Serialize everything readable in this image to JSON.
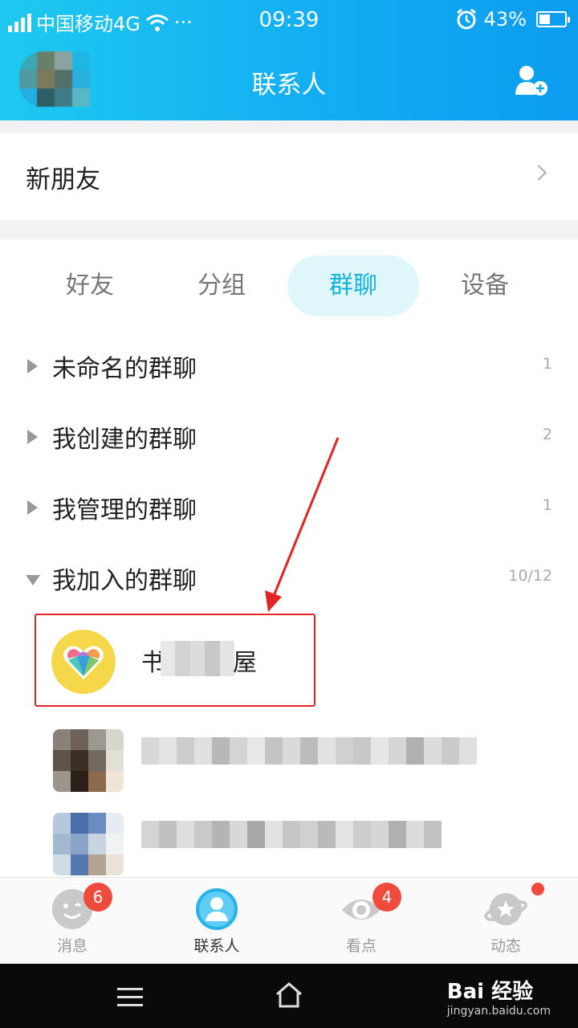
{
  "status_bar": {
    "carrier": "中国移动4G",
    "extra": "···",
    "time": "09:39",
    "battery": "43%",
    "battery_level": 0.43
  },
  "header": {
    "title": "联系人",
    "add_icon": "add-contact-icon"
  },
  "new_friends": {
    "label": "新朋友"
  },
  "tabs": [
    {
      "label": "好友"
    },
    {
      "label": "分组"
    },
    {
      "label": "群聊",
      "active": true
    },
    {
      "label": "设备"
    }
  ],
  "groups": [
    {
      "name": "未命名的群聊",
      "count": "1",
      "expanded": false
    },
    {
      "name": "我创建的群聊",
      "count": "2",
      "expanded": false
    },
    {
      "name": "我管理的群聊",
      "count": "1",
      "expanded": false
    },
    {
      "name": "我加入的群聊",
      "count": "10/12",
      "expanded": true
    }
  ],
  "joined_groups": [
    {
      "name_start": "书",
      "name_end": "屋",
      "icon": "heart-group-icon"
    }
  ],
  "bottom_nav": [
    {
      "label": "消息",
      "badge": "6",
      "icon": "message-icon"
    },
    {
      "label": "联系人",
      "icon": "contacts-icon",
      "active": true
    },
    {
      "label": "看点",
      "badge": "4",
      "icon": "eye-icon"
    },
    {
      "label": "动态",
      "icon": "planet-icon",
      "dot": true
    }
  ],
  "watermark": {
    "brand": "Bai 经验",
    "url": "jingyan.baidu.com"
  },
  "colors": {
    "header_start": "#1ec9f0",
    "header_end": "#0c9cf0",
    "accent": "#13b3e0",
    "badge": "#f04a3c",
    "annotation": "#e32424"
  }
}
